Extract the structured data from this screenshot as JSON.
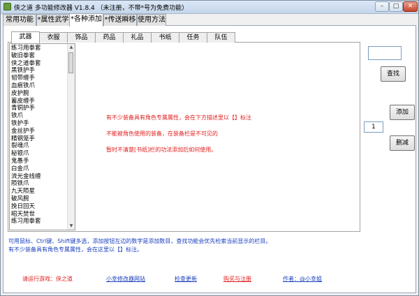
{
  "window": {
    "title": "侠之道 多功能修改器 V1.8.4 （未注册，不带*号为免费功能）",
    "minimize_label": "–",
    "maximize_label": "□",
    "close_label": "✕"
  },
  "main_tabs": [
    "常用功能",
    "*属性武学",
    "*各种添加",
    "*传送瞬移",
    "使用方法"
  ],
  "active_main_tab": "*各种添加",
  "sub_tabs": [
    "武器",
    "衣服",
    "饰品",
    "药品",
    "礼品",
    "书纸",
    "任务",
    "队伍"
  ],
  "active_sub_tab": "武器",
  "items": [
    "练习用拳套",
    "破旧拳套",
    "侠之道拳套",
    "黑铁护手",
    "韧带缠手",
    "血痕铁爪",
    "皮护腕",
    "蓄皮缠手",
    "青铜护手",
    "铁爪",
    "铁护手",
    "金丝护手",
    "精钢笼手",
    "裂魂爪",
    "秘银爪",
    "鬼愚手",
    "白金爪",
    "流光金线缠",
    "陨铁爪",
    "九天陨星",
    "破风腕",
    "挽日回天",
    "昭天焚世",
    "练习用拳套"
  ],
  "info_lines": [
    "有不少装备具有角色专属属性，会在下方描述里以【】标注",
    "不能被角色使用的装备，在装备栏是不可见的",
    "暂时不清楚[书纸]栏的功法添加后如何使用。"
  ],
  "search": {
    "value": "",
    "button_label": "查找"
  },
  "add": {
    "quantity": "1",
    "button_label": "添加"
  },
  "delete": {
    "button_label": "删减"
  },
  "hints": [
    "可用鼠标、Ctrl键、Shift键多选，添加按钮左边的数字是添加数目，查找功能会优先检索当前显示的栏目。",
    "有不少装备具有角色专属属性，会在这里以【】标注。"
  ],
  "footer": {
    "run_game": "请运行游戏：侠之道",
    "website": "小幸修改器网站",
    "check_update": "检查更新",
    "purchase": "购买与注册",
    "author": "作者：@小幸姐"
  },
  "colors": {
    "info_red": "#e02020",
    "hint_blue": "#1a3fbf",
    "titlebar": "#c5d6ea"
  }
}
